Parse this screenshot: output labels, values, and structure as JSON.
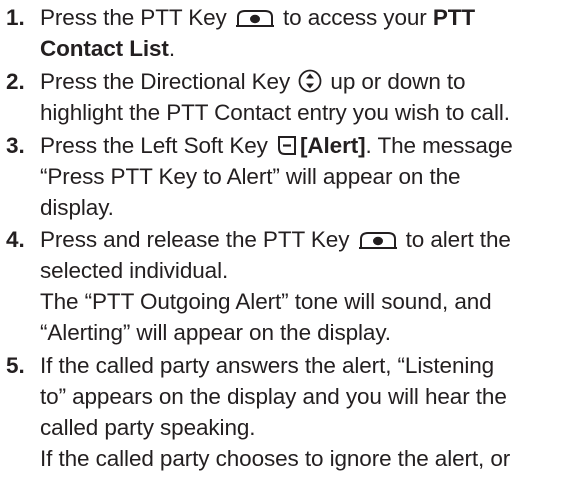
{
  "steps": [
    {
      "number": "1.",
      "lines": [
        {
          "a": "Press the PTT Key ",
          "b": " to access your ",
          "bold": "PTT"
        },
        {
          "bold": "Contact List",
          "tail": "."
        }
      ]
    },
    {
      "number": "2.",
      "lines": [
        {
          "a": "Press the Directional Key ",
          "b": " up or down to"
        },
        {
          "a": "highlight the PTT Contact entry you wish to call."
        }
      ]
    },
    {
      "number": "3.",
      "lines": [
        {
          "a": "Press the Left Soft Key ",
          "bold": "[Alert]",
          "tail": ". The message"
        },
        {
          "a": "“Press PTT Key to Alert” will appear on the"
        },
        {
          "a": "display."
        }
      ]
    },
    {
      "number": "4.",
      "lines": [
        {
          "a": "Press and release the PTT Key ",
          "b": " to alert the"
        },
        {
          "a": "selected individual."
        },
        {
          "a": "The “PTT Outgoing Alert” tone will sound, and"
        },
        {
          "a": "“Alerting” will appear on the display."
        }
      ]
    },
    {
      "number": "5.",
      "lines": [
        {
          "a": "If the called party answers the alert, “Listening"
        },
        {
          "a": "to” appears on the display and you will hear the"
        },
        {
          "a": "called party speaking."
        },
        {
          "a": "If the called party chooses to ignore the alert, or"
        }
      ]
    }
  ],
  "icons": {
    "ptt_key": "ptt-key-icon",
    "directional_key": "directional-key-icon",
    "left_soft_key": "left-soft-key-icon"
  },
  "colors": {
    "text": "#231f20",
    "background": "#ffffff"
  }
}
